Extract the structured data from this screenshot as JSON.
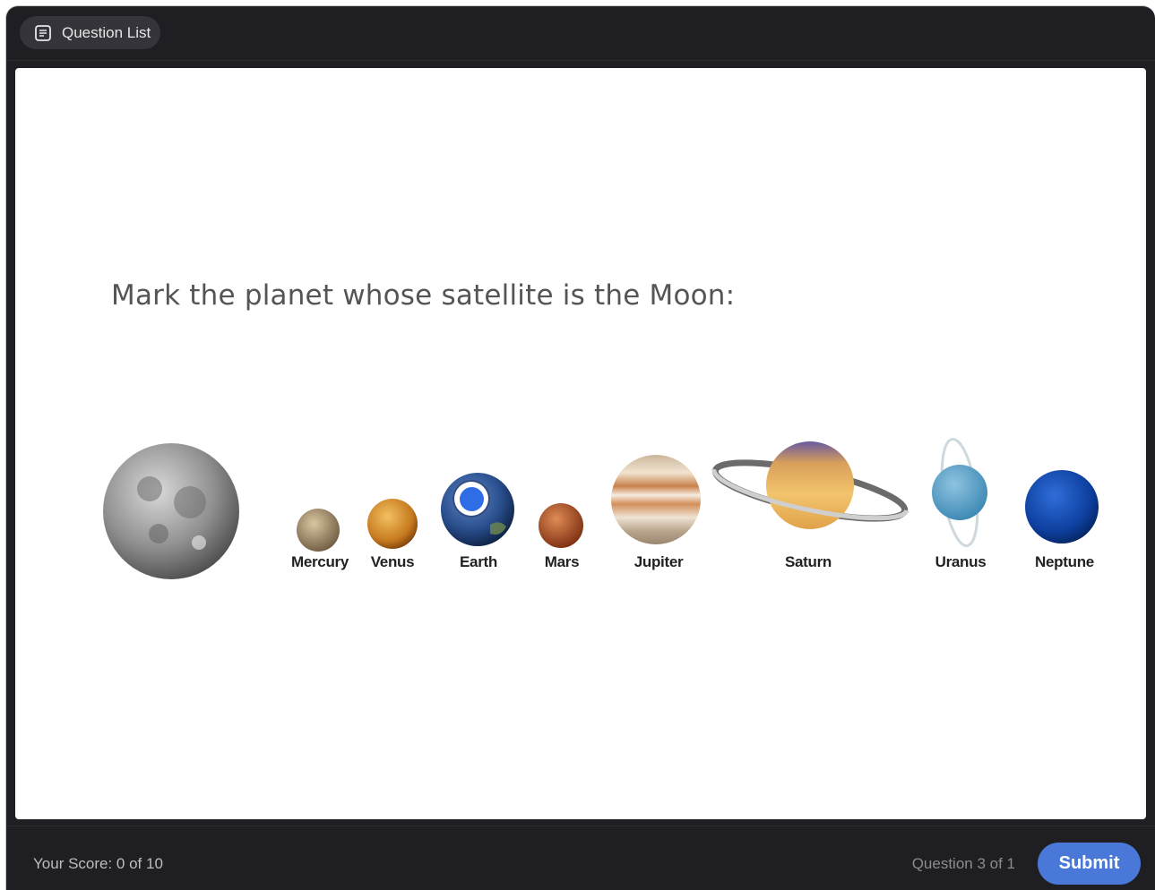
{
  "header": {
    "question_list_label": "Question List"
  },
  "question": {
    "prompt": "Mark the planet whose satellite is the Moon:"
  },
  "planets": [
    {
      "name": "Mercury"
    },
    {
      "name": "Venus"
    },
    {
      "name": "Earth",
      "selected": true
    },
    {
      "name": "Mars"
    },
    {
      "name": "Jupiter"
    },
    {
      "name": "Saturn"
    },
    {
      "name": "Uranus"
    },
    {
      "name": "Neptune"
    }
  ],
  "footer": {
    "score_text": "Your Score: 0 of 10",
    "question_counter": "Question 3 of 1",
    "submit_label": "Submit"
  },
  "colors": {
    "accent": "#4a78d8",
    "selected_dot": "#2f6de6",
    "chrome": "#1f1f23"
  }
}
